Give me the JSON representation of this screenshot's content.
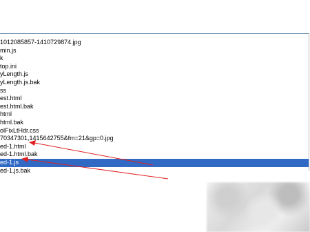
{
  "file_list": {
    "items": [
      {
        "name": "1012085857-1410729874.jpg",
        "selected": false
      },
      {
        "name": "min.js",
        "selected": false
      },
      {
        "name": "k",
        "selected": false
      },
      {
        "name": "top.ini",
        "selected": false
      },
      {
        "name": "yLength.js",
        "selected": false
      },
      {
        "name": "yLength.js.bak",
        "selected": false
      },
      {
        "name": "ss",
        "selected": false
      },
      {
        "name": "est.html",
        "selected": false
      },
      {
        "name": "est.html.bak",
        "selected": false
      },
      {
        "name": "html",
        "selected": false
      },
      {
        "name": "html.bak",
        "selected": false
      },
      {
        "name": "olFixLtHdr.css",
        "selected": false
      },
      {
        "name": "70347301,1415642755&fm=21&gp=0.jpg",
        "selected": false
      },
      {
        "name": "ed-1.html",
        "selected": false
      },
      {
        "name": "ed-1.html.bak",
        "selected": false
      },
      {
        "name": "ed-1.js",
        "selected": true
      },
      {
        "name": "ed-1.js.bak",
        "selected": false
      }
    ]
  },
  "colors": {
    "selection": "#316ac5",
    "annotation_arrow": "#e02020"
  }
}
